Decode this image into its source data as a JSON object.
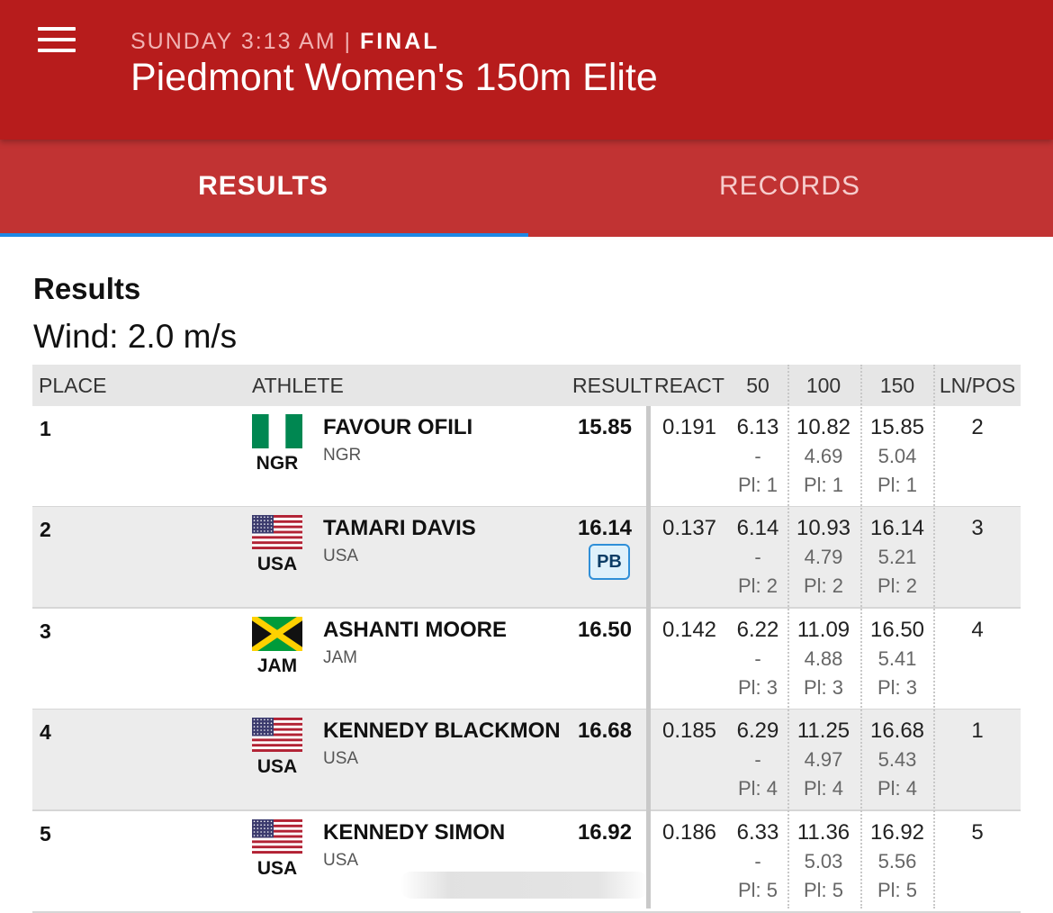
{
  "header": {
    "day_time": "SUNDAY 3:13 AM",
    "separator": "|",
    "status": "FINAL",
    "title": "Piedmont Women's 150m Elite"
  },
  "tabs": [
    {
      "label": "RESULTS",
      "active": true
    },
    {
      "label": "RECORDS",
      "active": false
    }
  ],
  "section": {
    "title": "Results",
    "wind": "Wind: 2.0 m/s"
  },
  "table": {
    "columns": [
      "PLACE",
      "ATHLETE",
      "RESULT",
      "REACT",
      "50",
      "100",
      "150",
      "LN/POS"
    ],
    "rows": [
      {
        "place": "1",
        "flag": "nigeria-flag",
        "country": "NGR",
        "name": "FAVOUR OFILI",
        "nat": "NGR",
        "result": "15.85",
        "badge": "",
        "react": "0.191",
        "s50": {
          "time": "6.13",
          "diff": "-",
          "place": "Pl: 1"
        },
        "s100": {
          "time": "10.82",
          "diff": "4.69",
          "place": "Pl: 1"
        },
        "s150": {
          "time": "15.85",
          "diff": "5.04",
          "place": "Pl: 1"
        },
        "lane": "2"
      },
      {
        "place": "2",
        "flag": "usa-flag",
        "country": "USA",
        "name": "TAMARI DAVIS",
        "nat": "USA",
        "result": "16.14",
        "badge": "PB",
        "react": "0.137",
        "s50": {
          "time": "6.14",
          "diff": "-",
          "place": "Pl: 2"
        },
        "s100": {
          "time": "10.93",
          "diff": "4.79",
          "place": "Pl: 2"
        },
        "s150": {
          "time": "16.14",
          "diff": "5.21",
          "place": "Pl: 2"
        },
        "lane": "3"
      },
      {
        "place": "3",
        "flag": "jamaica-flag",
        "country": "JAM",
        "name": "ASHANTI MOORE",
        "nat": "JAM",
        "result": "16.50",
        "badge": "",
        "react": "0.142",
        "s50": {
          "time": "6.22",
          "diff": "-",
          "place": "Pl: 3"
        },
        "s100": {
          "time": "11.09",
          "diff": "4.88",
          "place": "Pl: 3"
        },
        "s150": {
          "time": "16.50",
          "diff": "5.41",
          "place": "Pl: 3"
        },
        "lane": "4"
      },
      {
        "place": "4",
        "flag": "usa-flag",
        "country": "USA",
        "name": "KENNEDY BLACKMON",
        "nat": "USA",
        "result": "16.68",
        "badge": "",
        "react": "0.185",
        "s50": {
          "time": "6.29",
          "diff": "-",
          "place": "Pl: 4"
        },
        "s100": {
          "time": "11.25",
          "diff": "4.97",
          "place": "Pl: 4"
        },
        "s150": {
          "time": "16.68",
          "diff": "5.43",
          "place": "Pl: 4"
        },
        "lane": "1"
      },
      {
        "place": "5",
        "flag": "usa-flag",
        "country": "USA",
        "name": "KENNEDY SIMON",
        "nat": "USA",
        "result": "16.92",
        "badge": "",
        "react": "0.186",
        "s50": {
          "time": "6.33",
          "diff": "-",
          "place": "Pl: 5"
        },
        "s100": {
          "time": "11.36",
          "diff": "5.03",
          "place": "Pl: 5"
        },
        "s150": {
          "time": "16.92",
          "diff": "5.56",
          "place": "Pl: 5"
        },
        "lane": "5"
      }
    ]
  },
  "colors": {
    "header_bg": "#b71c1c",
    "tab_bg": "#c13333",
    "tab_indicator": "#1e88e5",
    "pb_border": "#2f8fd8",
    "pb_bg": "#dff1fb"
  }
}
